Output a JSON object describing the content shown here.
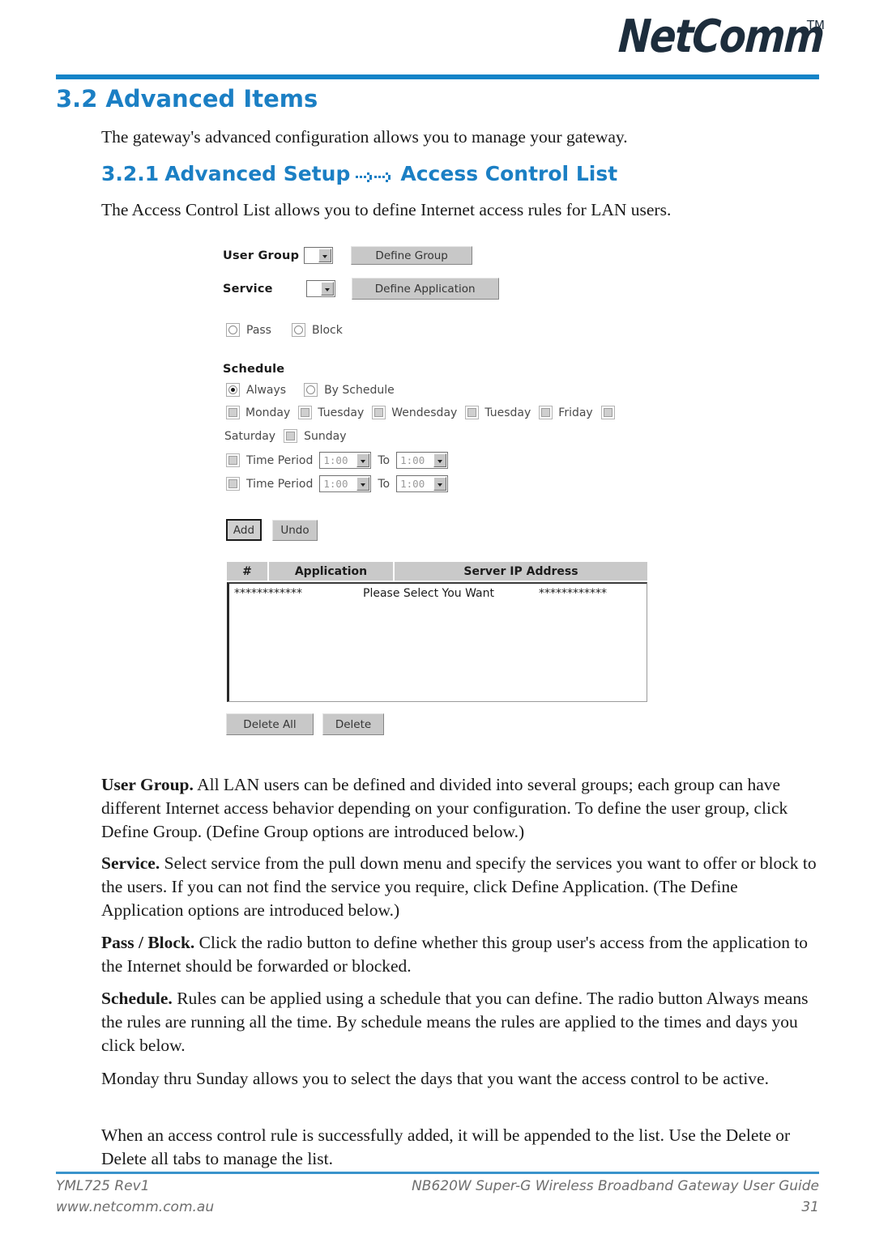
{
  "header": {
    "brand": "NetComm",
    "trademark": "TM"
  },
  "section": {
    "number": "3.2",
    "title": "Advanced Items",
    "intro": "The gateway's advanced configuration allows you to manage your gateway.",
    "sub_number": "3.2.1",
    "sub_title_left": "Advanced Setup",
    "sub_title_right": "Access Control List",
    "sub_intro": "The Access Control List allows you to define Internet access rules for LAN users."
  },
  "router_ui": {
    "user_group_label": "User Group",
    "define_group_button": "Define Group",
    "service_label": "Service",
    "define_application_button": "Define Application",
    "pass_label": "Pass",
    "block_label": "Block",
    "schedule_label": "Schedule",
    "always_label": "Always",
    "by_schedule_label": "By Schedule",
    "days": [
      "Monday",
      "Tuesday",
      "Wendesday",
      "Tuesday",
      "Friday",
      "Saturday",
      "Sunday"
    ],
    "time_period_label": "Time Period",
    "to_label": "To",
    "time_from_1": "1:00",
    "time_to_1": "1:00",
    "time_from_2": "1:00",
    "time_to_2": "1:00",
    "add_button": "Add",
    "undo_button": "Undo",
    "table_headers": [
      "#",
      "Application",
      "Server IP Address"
    ],
    "table_placeholder_left": "************",
    "table_placeholder_center": "Please Select You Want",
    "table_placeholder_right": "************",
    "delete_all_button": "Delete All",
    "delete_button": "Delete"
  },
  "body": {
    "p_user_group_lead": "User Group.",
    "p_user_group": " All LAN users can be defined and divided into several groups; each group can have different Internet access behavior depending on your configuration. To define the user group, click Define Group. (Define Group options are introduced below.)",
    "p_service_lead": "Service.",
    "p_service": " Select service from the pull down menu and specify the services you want to offer or block to the users. If you can not find the service you require, click Define Application. (The Define Application options are introduced below.)",
    "p_pass_block_lead": "Pass / Block.",
    "p_pass_block": " Click the radio button to define whether this group user's access from the application to the Internet should be forwarded or blocked.",
    "p_schedule_lead": "Schedule.",
    "p_schedule": " Rules can be applied using a schedule that you can define. The radio button Always means the rules are running all the time. By schedule means the rules are applied to the times and days you click below.",
    "p_days": "Monday thru Sunday allows you to select the days that you want the access control to be active.",
    "p_list": "When an access control rule is successfully added, it will be appended to the list. Use the Delete or Delete all tabs to manage the list."
  },
  "footer": {
    "doc_code": "YML725 Rev1",
    "website": "www.netcomm.com.au",
    "product": "NB620W Super-G Wireless Broadband  Gateway User Guide",
    "page_number": "31"
  },
  "colors": {
    "brand_blue": "#1b7fc4",
    "rule_blue": "#1484c8",
    "logo_navy": "#1d2d3c"
  }
}
